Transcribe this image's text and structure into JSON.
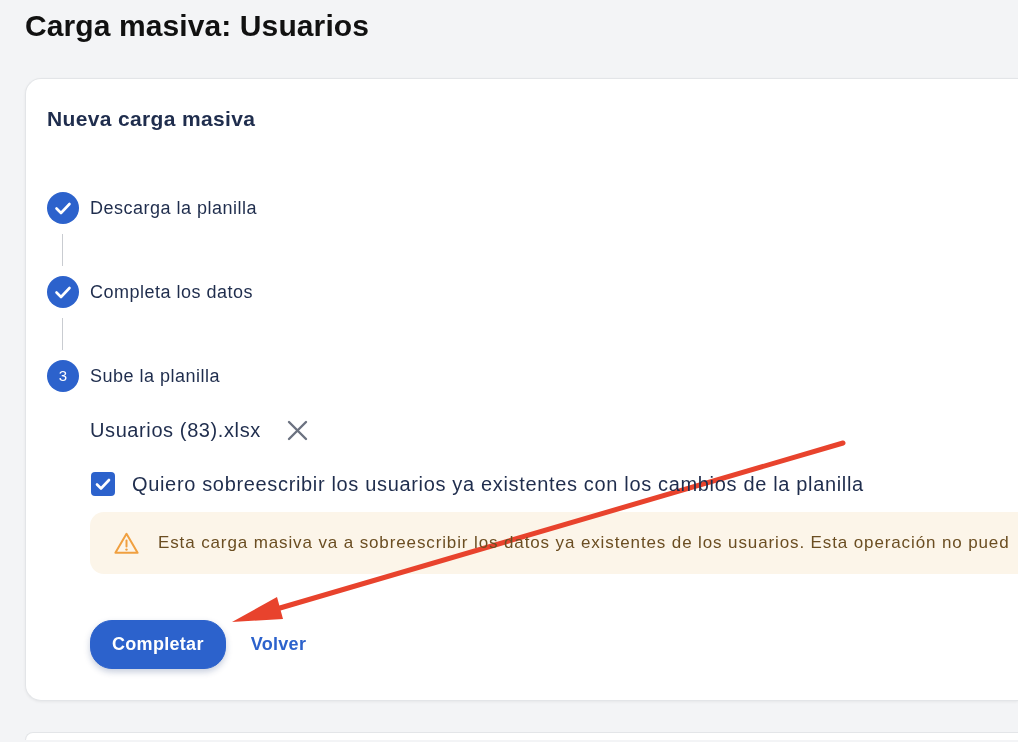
{
  "page": {
    "title": "Carga masiva: Usuarios"
  },
  "card": {
    "title": "Nueva carga masiva",
    "steps": [
      {
        "label": "Descarga la planilla",
        "completed": true
      },
      {
        "label": "Completa los datos",
        "completed": true
      },
      {
        "label": "Sube la planilla",
        "completed": false,
        "number": "3"
      }
    ],
    "file": {
      "name": "Usuarios (83).xlsx"
    },
    "overwrite": {
      "label": "Quiero sobreescribir los usuarios ya existentes con los cambios de la planilla",
      "checked": true
    },
    "alert": {
      "kind": "warning",
      "text": "Esta carga masiva va a sobreescribir los datos ya existentes de los usuarios. Esta operación no pued"
    },
    "buttons": [
      {
        "label": "Completar",
        "kind": "primary"
      },
      {
        "label": "Volver",
        "kind": "link"
      }
    ]
  },
  "annotations": [
    {
      "kind": "arrow"
    }
  ]
}
